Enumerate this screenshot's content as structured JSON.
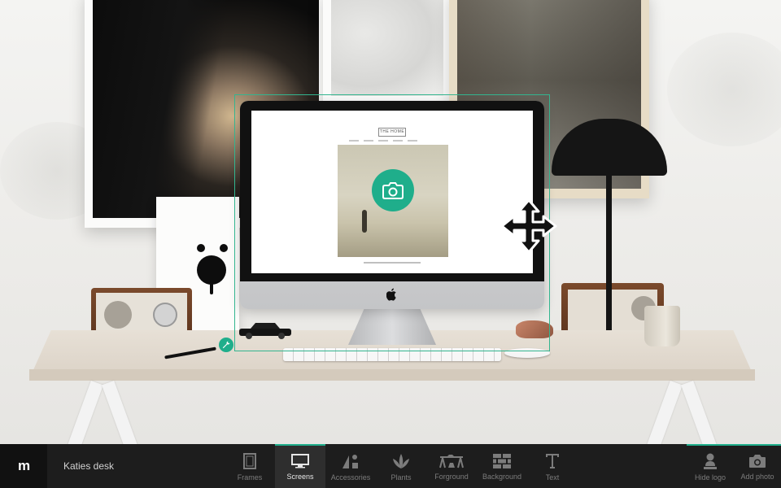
{
  "app": {
    "brand": "m",
    "project_name": "Katies desk"
  },
  "toolbar": {
    "tools": [
      {
        "id": "frames",
        "label": "Frames",
        "icon": "frame-icon",
        "active": false
      },
      {
        "id": "screens",
        "label": "Screens",
        "icon": "monitor-icon",
        "active": true
      },
      {
        "id": "accessories",
        "label": "Accessories",
        "icon": "accessories-icon",
        "active": false
      },
      {
        "id": "plants",
        "label": "Plants",
        "icon": "plant-icon",
        "active": false
      },
      {
        "id": "foreground",
        "label": "Forground",
        "icon": "foreground-icon",
        "active": false
      },
      {
        "id": "background",
        "label": "Background",
        "icon": "brick-wall-icon",
        "active": false
      },
      {
        "id": "text",
        "label": "Text",
        "icon": "text-icon",
        "active": false
      }
    ],
    "right": [
      {
        "id": "hide-logo",
        "label": "Hide logo",
        "icon": "user-stamp-icon"
      },
      {
        "id": "add-photo",
        "label": "Add photo",
        "icon": "camera-icon"
      }
    ]
  },
  "scene": {
    "screen_site_logo": "THE HOME",
    "selection_color": "#1fae8b",
    "accent": "#1fae8b"
  }
}
